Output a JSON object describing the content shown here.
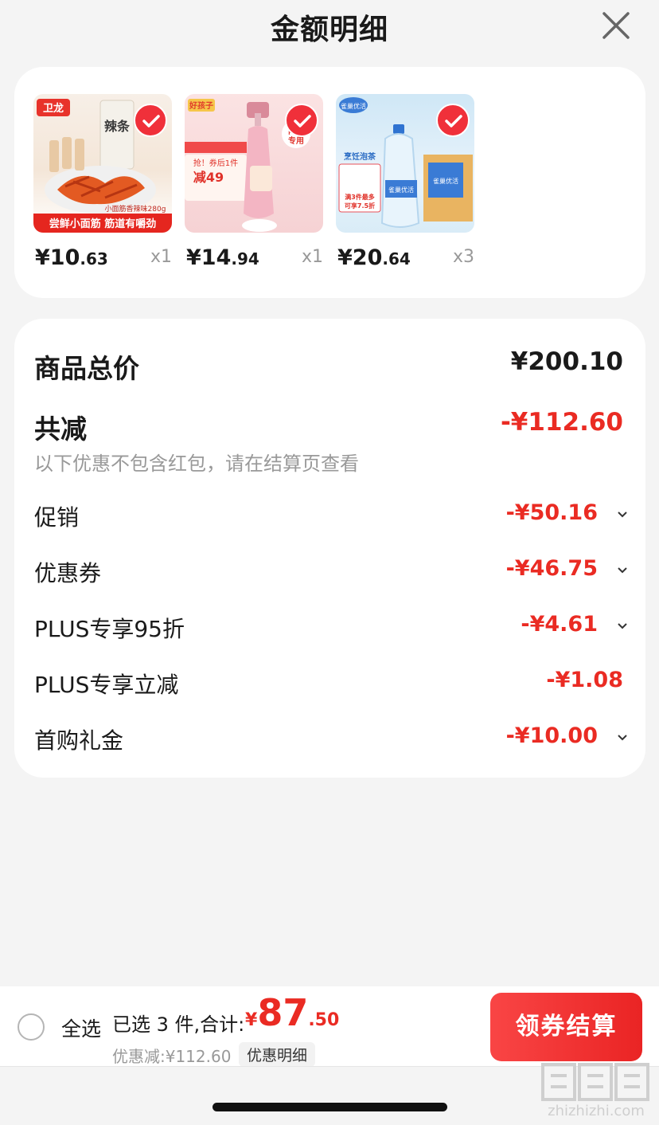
{
  "header": {
    "title": "金额明细",
    "close_icon": "close-icon"
  },
  "products": [
    {
      "name": "卫龙小面筋",
      "price_main": "¥10",
      "price_dec": ".63",
      "qty": "x1",
      "image_text": [
        "卫龙",
        "辣条",
        "小面筋香辣味280g",
        "尝鲜小面筋 筋道有嚼劲"
      ]
    },
    {
      "name": "好孩子泡沫洗衣液",
      "price_main": "¥14",
      "price_dec": ".94",
      "qty": "x1",
      "image_text": [
        "好孩子",
        "内衣专用",
        "抢！券后1件",
        "减49"
      ]
    },
    {
      "name": "雀巢优活饮用水",
      "price_main": "¥20",
      "price_dec": ".64",
      "qty": "x3",
      "image_text": [
        "烹饪泡茶",
        "满3件最多可享7.5折",
        "雀巢优活"
      ]
    }
  ],
  "summary": {
    "total_label": "商品总价",
    "total_value": "¥200.10",
    "reduce_label": "共减",
    "reduce_value": "-¥112.60",
    "note": "以下优惠不包含红包，请在结算页查看",
    "items": [
      {
        "label": "促销",
        "value": "-¥50.16",
        "has_chevron": true
      },
      {
        "label": "优惠券",
        "value": "-¥46.75",
        "has_chevron": true
      },
      {
        "label": "PLUS专享95折",
        "value": "-¥4.61",
        "has_chevron": true
      },
      {
        "label": "PLUS专享立减",
        "value": "-¥1.08",
        "has_chevron": false
      },
      {
        "label": "首购礼金",
        "value": "-¥10.00",
        "has_chevron": true
      }
    ]
  },
  "bottom_bar": {
    "select_all": "全选",
    "selected_text": "已选 3 件,合计:",
    "total_yen": "¥",
    "total_int": "87",
    "total_dec": ".50",
    "discount_text": "优惠减:¥112.60",
    "detail_link": "优惠明细",
    "checkout": "领券结算"
  },
  "watermark": {
    "logo": "值值值",
    "site": "zhizhizhi.com"
  },
  "colors": {
    "accent": "#ea2b23",
    "background": "#f4f4f4",
    "muted": "#999999"
  }
}
